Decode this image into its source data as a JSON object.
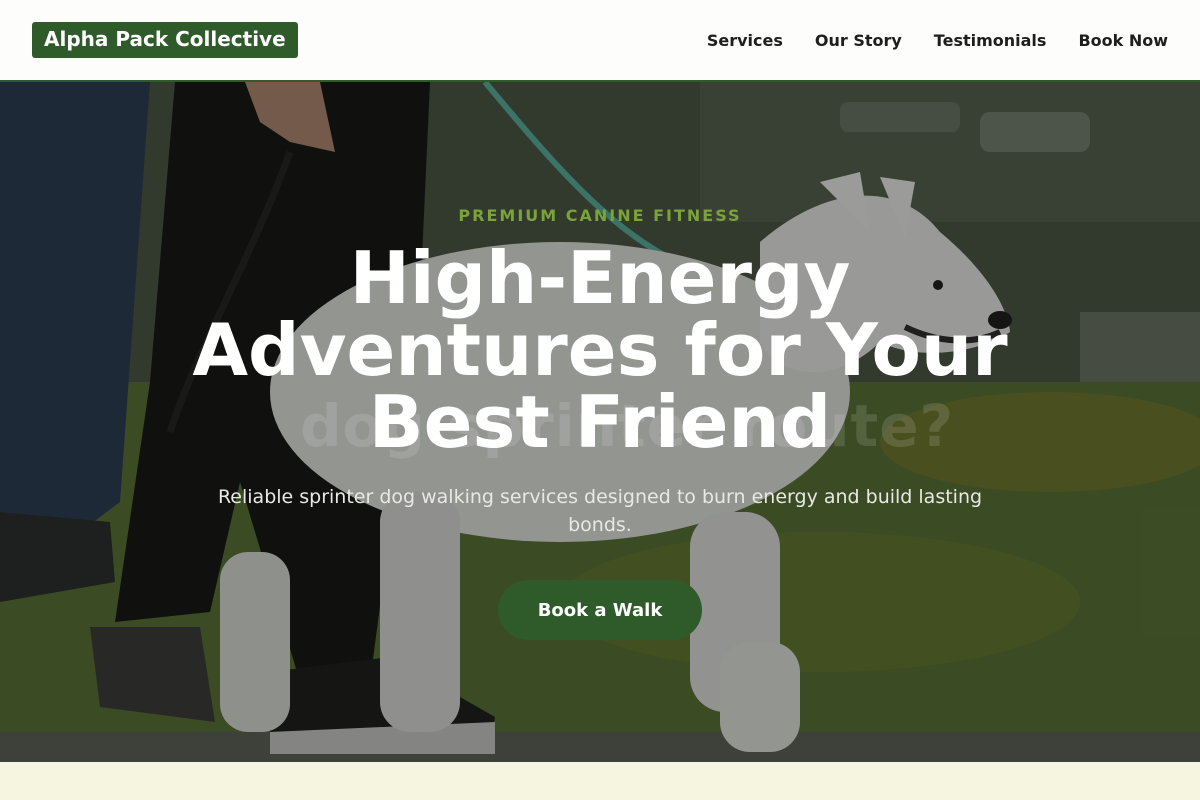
{
  "header": {
    "logo": "Alpha Pack Collective",
    "nav": [
      "Services",
      "Our Story",
      "Testimonials",
      "Book Now"
    ]
  },
  "hero": {
    "eyebrow": "PREMIUM CANINE FITNESS",
    "headline": "High-Energy Adventures for Your Best Friend",
    "subtext": "Reliable sprinter dog walking services designed to burn energy and build lasting bonds.",
    "cta": "Book a Walk",
    "background_text": "dog sprinter route?"
  },
  "colors": {
    "brand_green": "#2f5a2a",
    "accent_green": "#7aa33a",
    "page_bg": "#f6f5df"
  }
}
